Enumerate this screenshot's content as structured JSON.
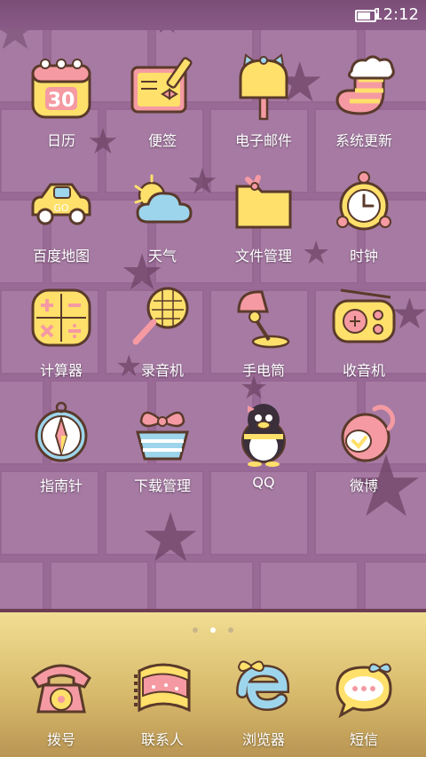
{
  "status_bar": {
    "time": "12:12",
    "battery_level": 0.9
  },
  "apps": [
    {
      "name": "calendar",
      "label": "日历",
      "icon": "calendar-icon"
    },
    {
      "name": "notes",
      "label": "便签",
      "icon": "notepad-icon"
    },
    {
      "name": "email",
      "label": "电子邮件",
      "icon": "mailbox-icon"
    },
    {
      "name": "system-update",
      "label": "系统更新",
      "icon": "sock-icon"
    },
    {
      "name": "baidu-map",
      "label": "百度地图",
      "icon": "car-icon"
    },
    {
      "name": "weather",
      "label": "天气",
      "icon": "weather-icon"
    },
    {
      "name": "file-manager",
      "label": "文件管理",
      "icon": "folder-icon"
    },
    {
      "name": "clock",
      "label": "时钟",
      "icon": "alarm-clock-icon"
    },
    {
      "name": "calculator",
      "label": "计算器",
      "icon": "calculator-icon"
    },
    {
      "name": "recorder",
      "label": "录音机",
      "icon": "microphone-icon"
    },
    {
      "name": "flashlight",
      "label": "手电筒",
      "icon": "lamp-icon"
    },
    {
      "name": "radio",
      "label": "收音机",
      "icon": "radio-icon"
    },
    {
      "name": "compass",
      "label": "指南针",
      "icon": "compass-icon"
    },
    {
      "name": "download-manager",
      "label": "下载管理",
      "icon": "download-box-icon"
    },
    {
      "name": "qq",
      "label": "QQ",
      "icon": "penguin-icon"
    },
    {
      "name": "weibo",
      "label": "微博",
      "icon": "weibo-icon"
    }
  ],
  "pager": {
    "pages": 3,
    "current": 2
  },
  "dock": [
    {
      "name": "dialer",
      "label": "拨号",
      "icon": "telephone-icon"
    },
    {
      "name": "contacts",
      "label": "联系人",
      "icon": "contacts-book-icon"
    },
    {
      "name": "browser",
      "label": "浏览器",
      "icon": "browser-e-icon"
    },
    {
      "name": "messages",
      "label": "短信",
      "icon": "chat-bubble-icon"
    }
  ],
  "colors": {
    "wall": "#9a6a97",
    "icon_yellow": "#ffe06b",
    "icon_pink": "#f59aa2",
    "icon_blue": "#9dd6ec",
    "outline": "#5a3a2a"
  }
}
